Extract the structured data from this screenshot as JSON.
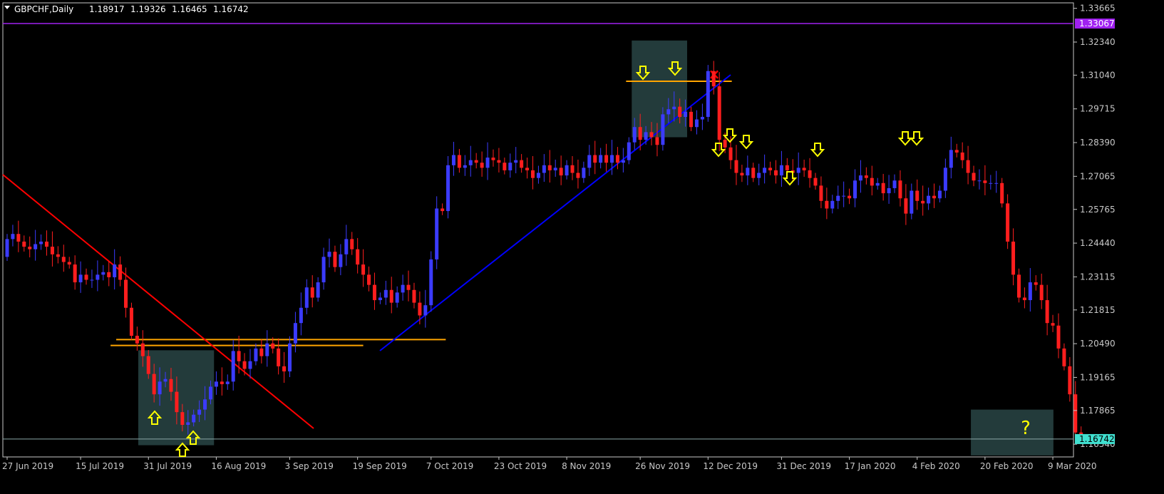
{
  "window": {
    "symbol": "GBPCHF",
    "timeframe": "Daily",
    "ohlc": [
      "1.18917",
      "1.19326",
      "1.16465",
      "1.16742"
    ]
  },
  "colors": {
    "background": "#000000",
    "bull_candle": "#3b3bff",
    "bear_candle": "#ff1e1e",
    "grid_axis": "#c8c8c8",
    "resistance_line": "#a020f0",
    "support_lines": "#ffa500",
    "downtrend_line": "#ff0000",
    "uptrend_line": "#0000ff",
    "highlight_box": "#2f4f4f",
    "arrows": "#ffff00",
    "price_tag": "#40e0d0"
  },
  "chart_data": {
    "type": "candlestick",
    "title": "GBPCHF,Daily",
    "ylim": [
      1.1604,
      1.3388
    ],
    "y_ticks": [
      "1.33665",
      "1.32340",
      "1.31040",
      "1.29715",
      "1.28390",
      "1.27065",
      "1.25765",
      "1.24440",
      "1.23115",
      "1.21815",
      "1.20490",
      "1.19165",
      "1.17865",
      "1.16540"
    ],
    "x_ticks": [
      "27 Jun 2019",
      "15 Jul 2019",
      "31 Jul 2019",
      "16 Aug 2019",
      "3 Sep 2019",
      "19 Sep 2019",
      "7 Oct 2019",
      "23 Oct 2019",
      "8 Nov 2019",
      "26 Nov 2019",
      "12 Dec 2019",
      "31 Dec 2019",
      "17 Jan 2020",
      "4 Feb 2020",
      "20 Feb 2020",
      "9 Mar 2020"
    ],
    "x_tick_index": [
      0,
      13,
      25,
      37,
      50,
      62,
      75,
      87,
      99,
      112,
      124,
      137,
      149,
      161,
      173,
      185
    ],
    "series": [
      {
        "open": [
          1.239,
          1.246,
          1.248,
          1.245,
          1.243,
          1.242,
          1.244,
          1.245,
          1.243,
          1.24,
          1.239,
          1.237,
          1.236,
          1.229,
          1.232,
          1.23,
          1.23,
          1.232,
          1.233,
          1.231,
          1.236,
          1.23,
          1.219,
          1.208,
          1.205,
          1.2,
          1.193,
          1.185,
          1.19,
          1.191,
          1.186,
          1.178,
          1.173,
          1.174,
          1.177,
          1.179,
          1.183,
          1.188,
          1.19,
          1.189,
          1.19,
          1.202,
          1.198,
          1.195,
          1.198,
          1.203,
          1.2,
          1.205,
          1.203,
          1.196,
          1.194,
          1.205,
          1.213,
          1.219,
          1.227,
          1.223,
          1.229,
          1.239,
          1.241,
          1.235,
          1.24,
          1.246,
          1.242,
          1.236,
          1.232,
          1.228,
          1.222,
          1.223,
          1.226,
          1.221,
          1.225,
          1.228,
          1.226,
          1.221,
          1.216,
          1.22,
          1.238,
          1.258,
          1.257,
          1.275,
          1.279,
          1.274,
          1.275,
          1.277,
          1.276,
          1.274,
          1.278,
          1.277,
          1.276,
          1.273,
          1.276,
          1.277,
          1.274,
          1.273,
          1.27,
          1.272,
          1.275,
          1.273,
          1.274,
          1.271,
          1.275,
          1.272,
          1.27,
          1.274,
          1.279,
          1.276,
          1.279,
          1.276,
          1.279,
          1.276,
          1.277,
          1.284,
          1.29,
          1.285,
          1.288,
          1.286,
          1.283,
          1.295,
          1.297,
          1.298,
          1.294,
          1.296,
          1.29,
          1.293,
          1.294,
          1.312,
          1.306,
          1.285,
          1.282,
          1.277,
          1.272,
          1.271,
          1.274,
          1.27,
          1.272,
          1.274,
          1.273,
          1.271,
          1.275,
          1.273,
          1.272,
          1.274,
          1.273,
          1.27,
          1.267,
          1.261,
          1.258,
          1.261,
          1.263,
          1.263,
          1.262,
          1.269,
          1.271,
          1.27,
          1.267,
          1.268,
          1.264,
          1.266,
          1.269,
          1.262,
          1.256,
          1.265,
          1.261,
          1.26,
          1.263,
          1.262,
          1.265,
          1.274,
          1.281,
          1.28,
          1.277,
          1.272,
          1.269,
          1.269,
          1.268,
          1.268,
          1.268,
          1.26,
          1.245,
          1.232,
          1.223,
          1.222,
          1.229,
          1.228,
          1.222,
          1.213,
          1.212,
          1.203,
          1.196,
          1.185,
          1.17
        ],
        "close": [
          1.246,
          1.248,
          1.245,
          1.243,
          1.242,
          1.244,
          1.245,
          1.243,
          1.24,
          1.239,
          1.237,
          1.236,
          1.229,
          1.232,
          1.23,
          1.23,
          1.232,
          1.233,
          1.231,
          1.236,
          1.23,
          1.219,
          1.208,
          1.205,
          1.2,
          1.193,
          1.185,
          1.19,
          1.191,
          1.186,
          1.178,
          1.173,
          1.174,
          1.177,
          1.179,
          1.183,
          1.188,
          1.19,
          1.189,
          1.19,
          1.202,
          1.198,
          1.195,
          1.198,
          1.203,
          1.2,
          1.205,
          1.203,
          1.196,
          1.194,
          1.205,
          1.213,
          1.219,
          1.227,
          1.223,
          1.229,
          1.239,
          1.241,
          1.235,
          1.24,
          1.246,
          1.242,
          1.236,
          1.232,
          1.228,
          1.222,
          1.223,
          1.226,
          1.221,
          1.225,
          1.228,
          1.226,
          1.221,
          1.216,
          1.22,
          1.238,
          1.258,
          1.257,
          1.275,
          1.279,
          1.274,
          1.275,
          1.277,
          1.276,
          1.274,
          1.278,
          1.277,
          1.276,
          1.273,
          1.276,
          1.277,
          1.274,
          1.273,
          1.27,
          1.272,
          1.275,
          1.273,
          1.274,
          1.271,
          1.275,
          1.272,
          1.27,
          1.274,
          1.279,
          1.276,
          1.279,
          1.276,
          1.279,
          1.276,
          1.277,
          1.284,
          1.29,
          1.285,
          1.288,
          1.286,
          1.283,
          1.295,
          1.297,
          1.298,
          1.294,
          1.296,
          1.29,
          1.293,
          1.294,
          1.312,
          1.306,
          1.285,
          1.282,
          1.277,
          1.272,
          1.271,
          1.274,
          1.27,
          1.272,
          1.274,
          1.273,
          1.271,
          1.275,
          1.273,
          1.272,
          1.274,
          1.273,
          1.27,
          1.267,
          1.261,
          1.258,
          1.261,
          1.263,
          1.263,
          1.262,
          1.269,
          1.271,
          1.27,
          1.267,
          1.268,
          1.264,
          1.266,
          1.269,
          1.262,
          1.256,
          1.265,
          1.261,
          1.26,
          1.263,
          1.262,
          1.265,
          1.274,
          1.281,
          1.28,
          1.277,
          1.272,
          1.269,
          1.269,
          1.268,
          1.268,
          1.268,
          1.26,
          1.245,
          1.232,
          1.223,
          1.222,
          1.229,
          1.228,
          1.222,
          1.213,
          1.212,
          1.203,
          1.196,
          1.185,
          1.17,
          1.1674
        ]
      }
    ],
    "horizontal_lines": [
      {
        "price": 1.33067,
        "label": "1.33067"
      },
      {
        "price": 1.16742,
        "label": "1.16742"
      }
    ],
    "support_levels": [
      1.2042,
      1.2065
    ],
    "breakout_level": 1.308,
    "question_mark": "?",
    "x_mark": "×"
  }
}
